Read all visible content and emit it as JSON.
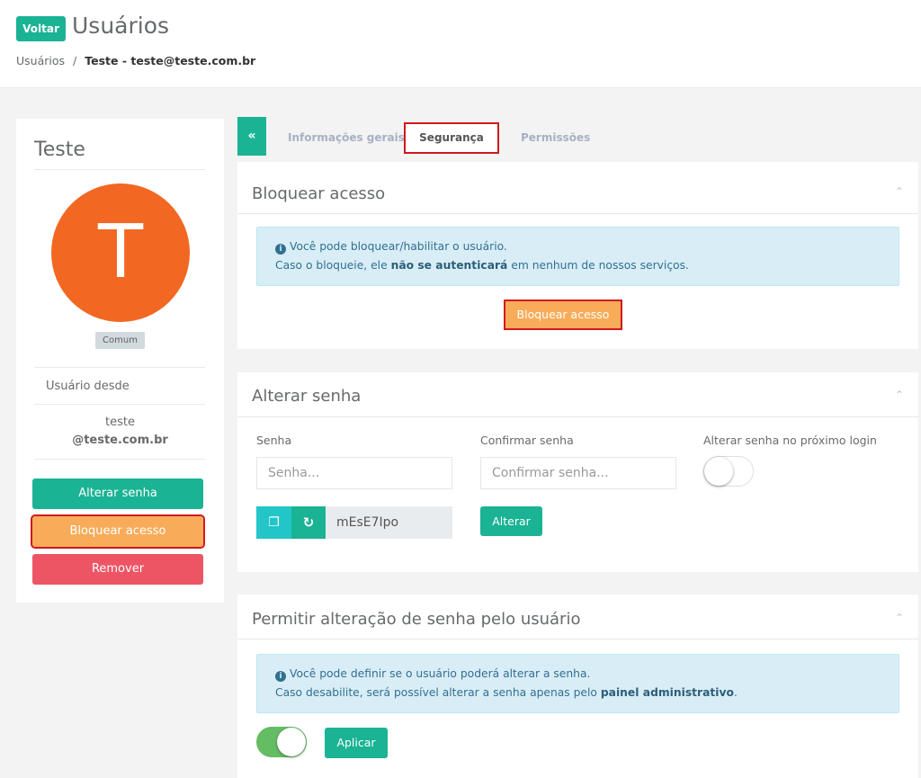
{
  "header": {
    "back_label": "Voltar",
    "title": "Usuários",
    "breadcrumb": {
      "root": "Usuários",
      "separator": "/",
      "current": "Teste - teste@teste.com.br"
    }
  },
  "profile": {
    "name": "Teste",
    "avatar_letter": "T",
    "avatar_color": "#f26722",
    "role_badge": "Comum",
    "since_label": "Usuário desde",
    "user_line1": "teste",
    "user_line2": "@teste.com.br",
    "buttons": {
      "change_password": "Alterar senha",
      "block_access": "Bloquear acesso",
      "remove": "Remover"
    }
  },
  "tabs": {
    "toggle_glyph": "«",
    "items": [
      {
        "label": "Informações gerais",
        "active": false
      },
      {
        "label": "Segurança",
        "active": true
      },
      {
        "label": "Permissões",
        "active": false
      }
    ]
  },
  "block_panel": {
    "title": "Bloquear acesso",
    "alert_line1": "Você pode bloquear/habilitar o usuário.",
    "alert_line2_pre": "Caso o bloqueie, ele ",
    "alert_line2_bold": "não se autenticará",
    "alert_line2_post": " em nenhum de nossos serviços.",
    "button": "Bloquear acesso"
  },
  "password_panel": {
    "title": "Alterar senha",
    "password_label": "Senha",
    "password_placeholder": "Senha...",
    "confirm_label": "Confirmar senha",
    "confirm_placeholder": "Confirmar senha...",
    "next_login_label": "Alterar senha no próximo login",
    "next_login_enabled": false,
    "generated_password": "mEsE7Ipo",
    "button": "Alterar"
  },
  "allow_change_panel": {
    "title": "Permitir alteração de senha pelo usuário",
    "alert_line1": "Você pode definir se o usuário poderá alterar a senha.",
    "alert_line2_pre": "Caso desabilite, será possível alterar a senha apenas pelo ",
    "alert_line2_bold": "painel administrativo",
    "alert_line2_post": ".",
    "enabled": true,
    "button": "Aplicar"
  },
  "colors": {
    "primary": "#1ab394",
    "warning": "#f8ac59",
    "danger": "#ed5565",
    "info": "#23c6c8",
    "highlight": "#d0191e"
  }
}
